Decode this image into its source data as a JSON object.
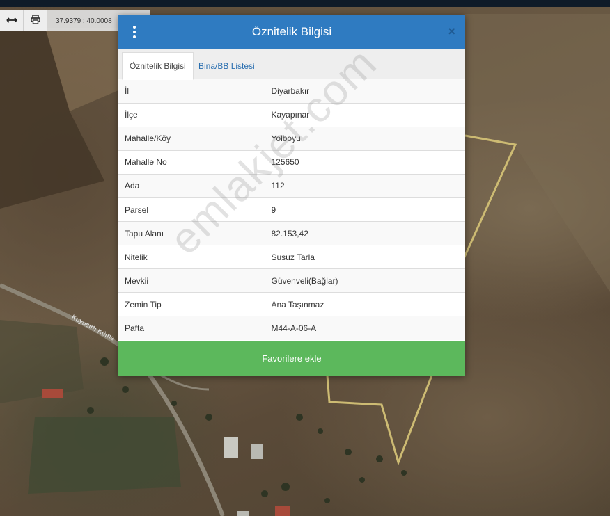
{
  "toolbar": {
    "coordinates": "37.9379 : 40.0008",
    "measure_icon": "arrows-horizontal-icon",
    "print_icon": "print-icon"
  },
  "map": {
    "road_label": "Kuyusırtı Küme",
    "parcel_outline_color": "#cdbb73"
  },
  "dialog": {
    "title": "Öznitelik Bilgisi",
    "close_label": "×",
    "header_color": "#2f7bc1",
    "tabs": [
      {
        "label": "Öznitelik Bilgisi",
        "active": true
      },
      {
        "label": "Bina/BB Listesi",
        "active": false
      }
    ],
    "rows": [
      {
        "key": "İl",
        "value": "Diyarbakır"
      },
      {
        "key": "İlçe",
        "value": "Kayapınar"
      },
      {
        "key": "Mahalle/Köy",
        "value": "Yolboyu"
      },
      {
        "key": "Mahalle No",
        "value": "125650"
      },
      {
        "key": "Ada",
        "value": "112"
      },
      {
        "key": "Parsel",
        "value": "9"
      },
      {
        "key": "Tapu Alanı",
        "value": "82.153,42"
      },
      {
        "key": "Nitelik",
        "value": "Susuz Tarla"
      },
      {
        "key": "Mevkii",
        "value": "Güvenveli(Bağlar)"
      },
      {
        "key": "Zemin Tip",
        "value": "Ana Taşınmaz"
      },
      {
        "key": "Pafta",
        "value": "M44-A-06-A"
      }
    ],
    "favorite_button": "Favorilere ekle",
    "favorite_color": "#5cb85c"
  },
  "watermark": "emlakjet.com"
}
